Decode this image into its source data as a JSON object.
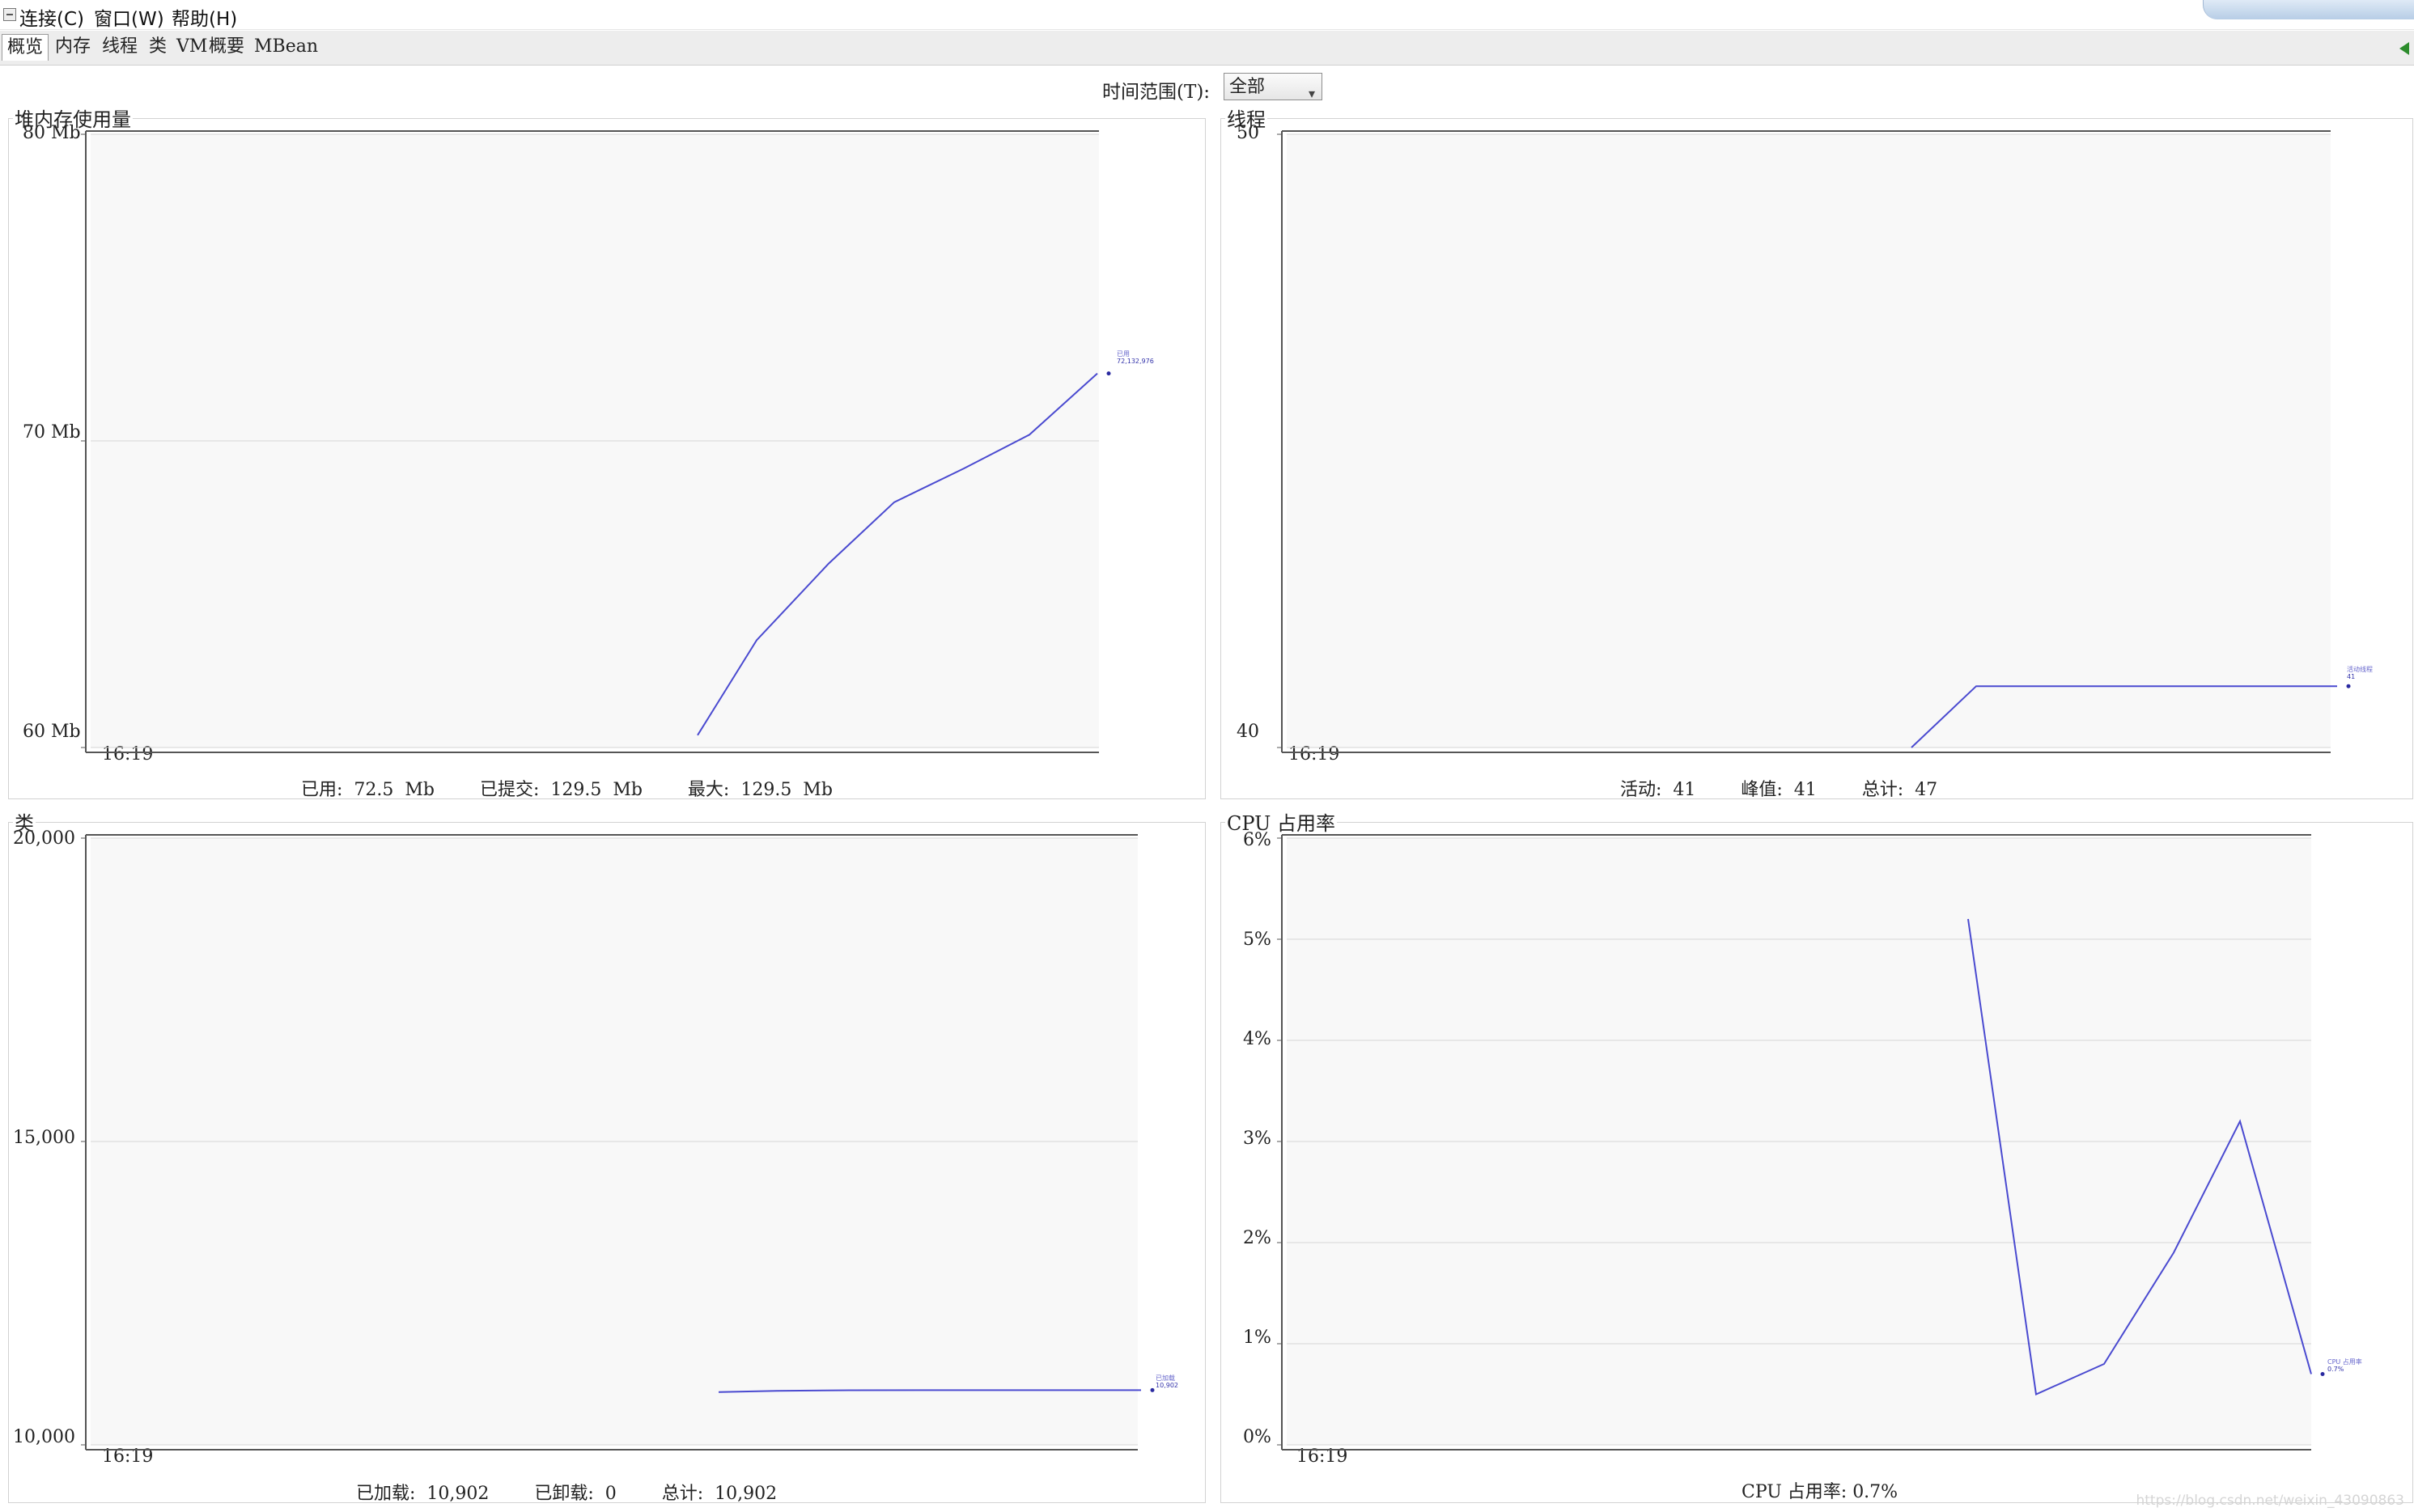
{
  "menubar": {
    "items": [
      "连接(C)",
      "窗口(W)",
      "帮助(H)"
    ]
  },
  "tabs": [
    "概览",
    "内存",
    "线程",
    "类",
    "VM",
    "概要",
    "MBean"
  ],
  "time_range": {
    "label": "时间范围(T):",
    "value": "全部"
  },
  "panels": {
    "heap": {
      "title": "堆内存使用量",
      "yticks": [
        "80 Mb",
        "70 Mb",
        "60 Mb"
      ],
      "xtick": "16:19",
      "legend_name": "已用",
      "legend_value": "72,132,976",
      "footer": [
        {
          "label": "已用:",
          "value": "72.5  Mb"
        },
        {
          "label": "已提交:",
          "value": "129.5  Mb"
        },
        {
          "label": "最大:",
          "value": "129.5  Mb"
        }
      ]
    },
    "threads": {
      "title": "线程",
      "yticks": [
        "50",
        "40"
      ],
      "xtick": "16:19",
      "legend_name": "活动线程",
      "legend_value": "41",
      "footer": [
        {
          "label": "活动:",
          "value": "41"
        },
        {
          "label": "峰值:",
          "value": "41"
        },
        {
          "label": "总计:",
          "value": "47"
        }
      ]
    },
    "classes": {
      "title": "类",
      "yticks": [
        "20,000",
        "15,000",
        "10,000"
      ],
      "xtick": "16:19",
      "legend_name": "已加载",
      "legend_value": "10,902",
      "footer": [
        {
          "label": "已加载:",
          "value": "10,902"
        },
        {
          "label": "已卸载:",
          "value": "0"
        },
        {
          "label": "总计:",
          "value": "10,902"
        }
      ]
    },
    "cpu": {
      "title": "CPU 占用率",
      "yticks": [
        "6%",
        "5%",
        "4%",
        "3%",
        "2%",
        "1%",
        "0%"
      ],
      "xtick": "16:19",
      "legend_name": "CPU 占用率",
      "legend_value": "0.7%",
      "footer_text": "CPU 占用率: 0.7%"
    }
  },
  "chart_data": [
    {
      "type": "line",
      "title": "堆内存使用量",
      "ylim": [
        60,
        80
      ],
      "series": [
        {
          "name": "已用",
          "values": [
            60.4,
            63.5,
            66.0,
            68.0,
            69.1,
            70.2,
            72.2
          ]
        }
      ],
      "color": "#4a4ad0"
    },
    {
      "type": "line",
      "title": "线程",
      "ylim": [
        40,
        50
      ],
      "series": [
        {
          "name": "活动线程",
          "values": [
            40,
            41,
            41,
            41,
            41
          ]
        }
      ],
      "color": "#4a4ad0"
    },
    {
      "type": "line",
      "title": "类",
      "ylim": [
        10000,
        20000
      ],
      "series": [
        {
          "name": "已加载",
          "values": [
            10870,
            10890,
            10900,
            10902,
            10902,
            10902,
            10902
          ]
        }
      ],
      "color": "#4a4ad0"
    },
    {
      "type": "line",
      "title": "CPU 占用率",
      "ylim": [
        0,
        6
      ],
      "series": [
        {
          "name": "CPU 占用率",
          "values": [
            5.2,
            0.5,
            0.8,
            1.9,
            3.2,
            0.7
          ]
        }
      ],
      "color": "#4a4ad0"
    }
  ],
  "watermark": "https://blog.csdn.net/weixin_43090863"
}
